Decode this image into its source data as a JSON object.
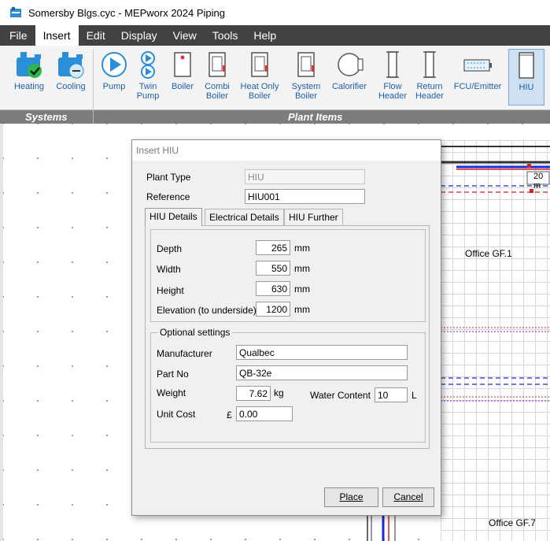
{
  "window": {
    "title": "Somersby Blgs.cyc - MEPworx 2024 Piping"
  },
  "menu": [
    "File",
    "Insert",
    "Edit",
    "Display",
    "View",
    "Tools",
    "Help"
  ],
  "ribbon": {
    "groups": [
      "Systems",
      "Plant Items"
    ],
    "buttons": [
      {
        "label": "Heating",
        "icon": "heating-system-icon"
      },
      {
        "label": "Cooling",
        "icon": "cooling-system-icon"
      },
      {
        "label": "Pump",
        "icon": "pump-icon"
      },
      {
        "label": "Twin\nPump",
        "icon": "twin-pump-icon"
      },
      {
        "label": "Boiler",
        "icon": "boiler-icon"
      },
      {
        "label": "Combi\nBoiler",
        "icon": "combi-boiler-icon"
      },
      {
        "label": "Heat Only\nBoiler",
        "icon": "heat-only-boiler-icon"
      },
      {
        "label": "System\nBoiler",
        "icon": "system-boiler-icon"
      },
      {
        "label": "Calorifier",
        "icon": "calorifier-icon"
      },
      {
        "label": "Flow\nHeader",
        "icon": "flow-header-icon"
      },
      {
        "label": "Return\nHeader",
        "icon": "return-header-icon"
      },
      {
        "label": "FCU/Emitter",
        "icon": "fcu-emitter-icon"
      },
      {
        "label": "HIU",
        "icon": "hiu-icon"
      }
    ]
  },
  "drawing": {
    "rooms": [
      "Office GF.1",
      "Office GF.7"
    ],
    "dimension_text": "20 m"
  },
  "dialog": {
    "title": "Insert HIU",
    "plant_type_label": "Plant Type",
    "plant_type_value": "HIU",
    "reference_label": "Reference",
    "reference_value": "HIU001",
    "tabs": [
      "HIU Details",
      "Electrical Details",
      "HIU Further"
    ],
    "depth_label": "Depth",
    "depth_value": "265",
    "depth_unit": "mm",
    "width_label": "Width",
    "width_value": "550",
    "width_unit": "mm",
    "height_label": "Height",
    "height_value": "630",
    "height_unit": "mm",
    "elevation_label": "Elevation (to underside)",
    "elevation_value": "1200",
    "elevation_unit": "mm",
    "optional_title": "Optional settings",
    "manufacturer_label": "Manufacturer",
    "manufacturer_value": "Qualbec",
    "part_label": "Part No",
    "part_value": "QB-32e",
    "weight_label": "Weight",
    "weight_value": "7.62",
    "weight_unit": "kg",
    "water_label": "Water Content",
    "water_value": "10",
    "water_unit": "L",
    "cost_label": "Unit Cost",
    "cost_symbol": "£",
    "cost_value": "0.00",
    "place_button": "Place",
    "cancel_button": "Cancel"
  },
  "colors": {
    "menubar": "#424242",
    "ribbon_label": "#1f5fa8",
    "ribbon_icon": "#2a8fd8",
    "groupbar": "#7c7c7c"
  }
}
